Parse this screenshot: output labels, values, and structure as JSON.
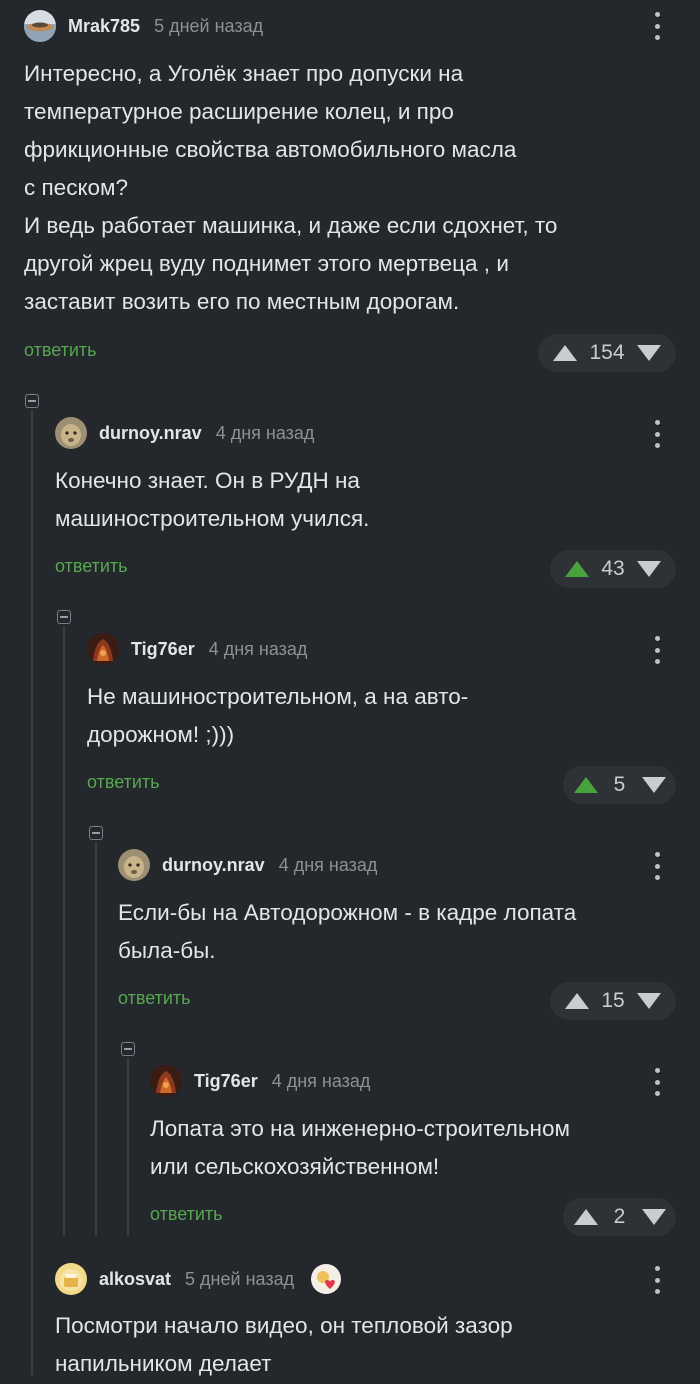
{
  "comments": [
    {
      "author": "Mrak785",
      "time": "5 дней назад",
      "text": "Интересно, а Уголёк знает про допуски на\nтемпературное расширение колец, и про\nфрикционные свойства автомобильного масла\nс песком?\nИ ведь работает машинка, и даже если сдохнет, то\nдругой жрец вуду поднимет этого мертвеца , и\nзаставит возить его по местным дорогам.",
      "reply": "ответить",
      "score": "154"
    },
    {
      "author": "durnoy.nrav",
      "time": "4 дня назад",
      "text": "Конечно знает. Он в РУДН на\nмашиностроительном учился.",
      "reply": "ответить",
      "score": "43"
    },
    {
      "author": "Tig76er",
      "time": "4 дня назад",
      "text": "Не машиностроительном, а на авто-\nдорожном! ;)))",
      "reply": "ответить",
      "score": "5"
    },
    {
      "author": "durnoy.nrav",
      "time": "4 дня назад",
      "text": "Если-бы на Автодорожном - в кадре лопата\nбыла-бы.",
      "reply": "ответить",
      "score": "15"
    },
    {
      "author": "Tig76er",
      "time": "4 дня назад",
      "text": "Лопата это на инженерно-строительном\nили сельскохозяйственном!",
      "reply": "ответить",
      "score": "2"
    },
    {
      "author": "alkosvat",
      "time": "5 дней назад",
      "text": "Посмотри начало видео, он тепловой зазор\nнапильником делает"
    }
  ],
  "colors": {
    "background": "#24272c",
    "reply_link": "#57a84f",
    "upvote_active": "#4aa23d",
    "rating_bg": "#2e3136"
  }
}
